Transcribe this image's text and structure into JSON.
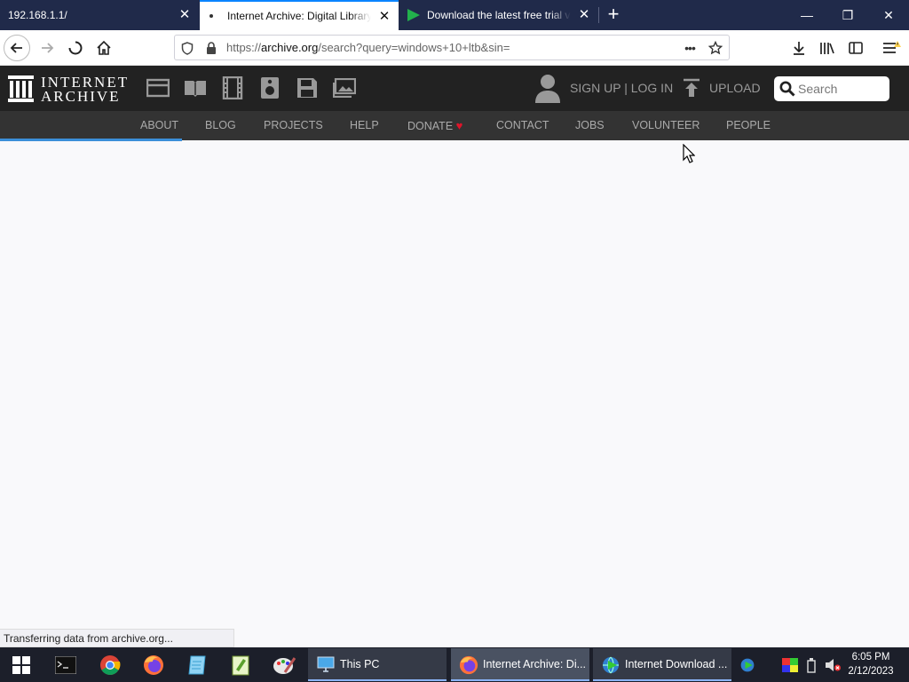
{
  "browser": {
    "tabs": [
      {
        "title": "192.168.1.1/",
        "active": false
      },
      {
        "title": "Internet Archive: Digital Library",
        "active": true
      },
      {
        "title": "Download the latest free trial v",
        "active": false
      }
    ],
    "close_glyph": "✕",
    "new_tab_glyph": "+",
    "window_controls": {
      "minimize": "—",
      "restore": "❐",
      "close": "✕"
    },
    "url_prefix": "https://",
    "url_domain": "archive.org",
    "url_path": "/search?query=windows+10+ltb&sin=",
    "page_actions": "•••"
  },
  "ia": {
    "logo_line1": "INTERNET",
    "logo_line2": "ARCHIVE",
    "media_icons": [
      "web-icon",
      "texts-icon",
      "video-icon",
      "audio-icon",
      "software-icon",
      "images-icon"
    ],
    "account_label": "SIGN UP | LOG IN",
    "upload_label": "UPLOAD",
    "search_placeholder": "Search",
    "nav": [
      "ABOUT",
      "BLOG",
      "PROJECTS",
      "HELP",
      "DONATE",
      "CONTACT",
      "JOBS",
      "VOLUNTEER",
      "PEOPLE"
    ],
    "donate_heart": "♥",
    "page_load_progress": 0.2
  },
  "status_text": "Transferring data from archive.org...",
  "taskbar": {
    "pinned": [
      "windows-start-icon",
      "terminal-icon",
      "chrome-icon",
      "firefox-icon",
      "notepad-icon",
      "notepadpp-icon",
      "paint-icon"
    ],
    "apps": [
      {
        "label": "This PC"
      },
      {
        "label": "Internet Archive: Di..."
      },
      {
        "label": "Internet Download ..."
      }
    ],
    "time": "6:05 PM",
    "date": "2/12/2023"
  },
  "colors": {
    "tabstrip": "#202a4a",
    "active_tab_accent": "#0a84ff",
    "ia_header": "#222222",
    "ia_nav": "#333333",
    "donate_heart": "#e0142a",
    "progress": "#3b8fd9"
  }
}
